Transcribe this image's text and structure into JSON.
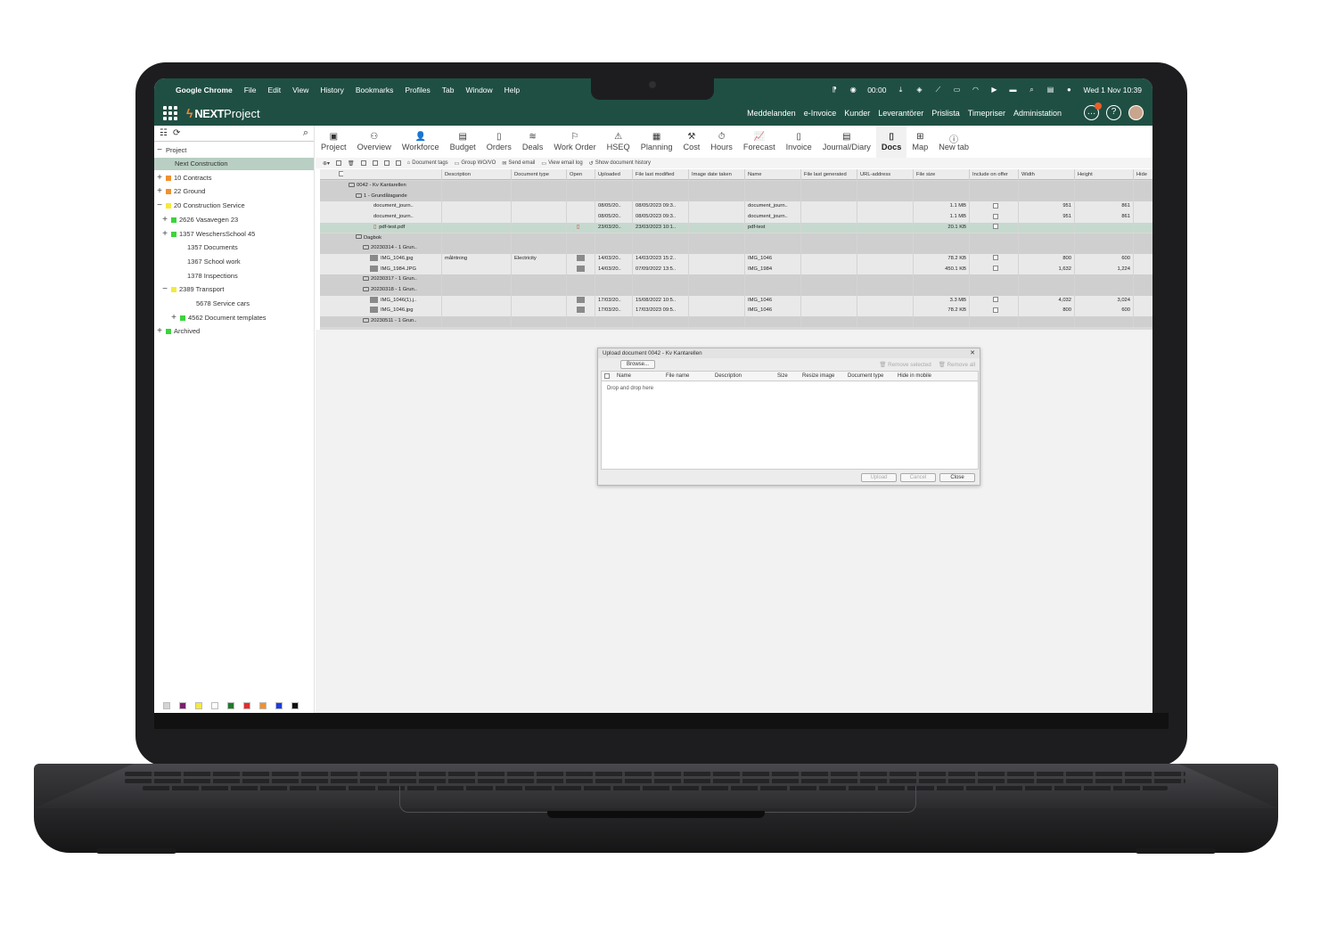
{
  "menubar": {
    "app": "Google Chrome",
    "items": [
      "File",
      "Edit",
      "View",
      "History",
      "Bookmarks",
      "Profiles",
      "Tab",
      "Window",
      "Help"
    ],
    "timer": "00:00",
    "datetime": "Wed 1 Nov 10:39"
  },
  "appbar": {
    "logo_mark": "NEXT",
    "logo_text": "Project",
    "nav": [
      "Meddelanden",
      "e-Invoice",
      "Kunder",
      "Leverantörer",
      "Prislista",
      "Timepriser",
      "Administation"
    ]
  },
  "sidebar": {
    "root": "Project",
    "items": [
      {
        "label": "Next Construction",
        "pm": "",
        "color": ""
      },
      {
        "label": "10 Contracts",
        "pm": "+",
        "color": "#f0902e"
      },
      {
        "label": "22 Ground",
        "pm": "+",
        "color": "#f0902e"
      },
      {
        "label": "20 Construction Service",
        "pm": "−",
        "color": "#f4ea3c"
      },
      {
        "label": "2626 Vasavegen 23",
        "pm": "+",
        "color": "#3cd43c"
      },
      {
        "label": "1357 WeschersSchool 45",
        "pm": "+",
        "color": "#3cd43c"
      },
      {
        "label": "1357 Documents",
        "pm": "",
        "color": ""
      },
      {
        "label": "1367 School work",
        "pm": "",
        "color": ""
      },
      {
        "label": "1378 Inspections",
        "pm": "",
        "color": ""
      },
      {
        "label": "2389 Transport",
        "pm": "−",
        "color": "#f4ea3c"
      },
      {
        "label": "5678 Service cars",
        "pm": "",
        "color": ""
      },
      {
        "label": "4562 Document templates",
        "pm": "+",
        "color": "#3cd43c"
      },
      {
        "label": "Archived",
        "pm": "+",
        "color": "#3cd43c"
      }
    ],
    "palette": [
      "#d4d4d4",
      "#7b1f6e",
      "#f4ea3c",
      "#ffffff",
      "#1f7a2c",
      "#e62b2b",
      "#f0902e",
      "#1c3de0",
      "#111111"
    ]
  },
  "modules": [
    {
      "label": "Project",
      "icon": "briefcase-icon",
      "glyph": "▣"
    },
    {
      "label": "Overview",
      "icon": "overview-icon",
      "glyph": "⚇"
    },
    {
      "label": "Workforce",
      "icon": "person-icon",
      "glyph": "👤"
    },
    {
      "label": "Budget",
      "icon": "budget-icon",
      "glyph": "▤"
    },
    {
      "label": "Orders",
      "icon": "orders-icon",
      "glyph": "▯"
    },
    {
      "label": "Deals",
      "icon": "deals-icon",
      "glyph": "≋"
    },
    {
      "label": "Work Order",
      "icon": "flag-icon",
      "glyph": "⚐"
    },
    {
      "label": "HSEQ",
      "icon": "warning-icon",
      "glyph": "⚠"
    },
    {
      "label": "Planning",
      "icon": "calendar-icon",
      "glyph": "▦"
    },
    {
      "label": "Cost",
      "icon": "cost-icon",
      "glyph": "⚒"
    },
    {
      "label": "Hours",
      "icon": "stopwatch-icon",
      "glyph": "⏱"
    },
    {
      "label": "Forecast",
      "icon": "chart-icon",
      "glyph": "📈"
    },
    {
      "label": "Invoice",
      "icon": "invoice-icon",
      "glyph": "▯"
    },
    {
      "label": "Journal/Diary",
      "icon": "journal-icon",
      "glyph": "▤"
    },
    {
      "label": "Docs",
      "icon": "document-icon",
      "glyph": "▯",
      "active": true
    },
    {
      "label": "Map",
      "icon": "map-icon",
      "glyph": "⊞"
    },
    {
      "label": "New tab",
      "icon": "info-icon",
      "glyph": "ⓘ"
    }
  ],
  "actions": [
    "Document tags",
    "Group WO/VO",
    "Send email",
    "View email log",
    "Show document history"
  ],
  "grid": {
    "headers": [
      "Description",
      "Document type",
      "Open",
      "Uploaded",
      "File last modified",
      "Image date taken",
      "Name",
      "File last generated",
      "URL-address",
      "File size",
      "Include on offer",
      "Width",
      "Height",
      "Hide"
    ],
    "rows": [
      {
        "tree": "0042 - Kv Kantarellen",
        "indent": 12,
        "kind": "folder",
        "style": "shade"
      },
      {
        "tree": "1 - Grundåtagande",
        "indent": 20,
        "kind": "folder",
        "style": "shade"
      },
      {
        "tree": "document_journ..",
        "indent": 40,
        "kind": "file",
        "style": "light",
        "uploaded": "08/05/20..",
        "modified": "08/05/2023 09:3..",
        "name": "document_journ..",
        "size": "1.1 MB",
        "w": "951",
        "h": "861"
      },
      {
        "tree": "document_journ..",
        "indent": 40,
        "kind": "file",
        "style": "light",
        "uploaded": "08/05/20..",
        "modified": "08/05/2023 09:3..",
        "name": "document_journ..",
        "size": "1.1 MB",
        "w": "951",
        "h": "861"
      },
      {
        "tree": "pdf-test.pdf",
        "indent": 40,
        "kind": "pdf",
        "style": "hl",
        "uploaded": "23/03/20..",
        "modified": "23/03/2023 10:1..",
        "name": "pdf-test",
        "size": "20.1 KB",
        "w": "",
        "h": ""
      },
      {
        "tree": "Dagbok",
        "indent": 20,
        "kind": "folder",
        "style": "shade"
      },
      {
        "tree": "20230314 - 1 Grun..",
        "indent": 28,
        "kind": "folder",
        "style": "shade"
      },
      {
        "tree": "IMG_1046.jpg",
        "indent": 36,
        "kind": "img",
        "style": "light",
        "desc": "målritning",
        "doctype": "Electricity",
        "uploaded": "14/03/20..",
        "modified": "14/03/2023 15:2..",
        "name": "IMG_1046",
        "size": "78.2 KB",
        "w": "800",
        "h": "600"
      },
      {
        "tree": "IMG_1984.JPG",
        "indent": 36,
        "kind": "img",
        "style": "light",
        "uploaded": "14/03/20..",
        "modified": "07/09/2022 13:5..",
        "name": "IMG_1984",
        "size": "450.1 KB",
        "w": "1,632",
        "h": "1,224"
      },
      {
        "tree": "20230317 - 1 Grun..",
        "indent": 28,
        "kind": "folder",
        "style": "shade"
      },
      {
        "tree": "20230318 - 1 Grun..",
        "indent": 28,
        "kind": "folder",
        "style": "shade"
      },
      {
        "tree": "IMG_1046(1).j..",
        "indent": 36,
        "kind": "img",
        "style": "light",
        "uploaded": "17/03/20..",
        "modified": "15/08/2022 10:5..",
        "name": "IMG_1046",
        "size": "3.3 MB",
        "w": "4,032",
        "h": "3,024"
      },
      {
        "tree": "IMG_1046.jpg",
        "indent": 36,
        "kind": "img",
        "style": "light",
        "uploaded": "17/03/20..",
        "modified": "17/03/2023 09:5..",
        "name": "IMG_1046",
        "size": "78.2 KB",
        "w": "800",
        "h": "600"
      },
      {
        "tree": "20230511 - 1 Grun..",
        "indent": 28,
        "kind": "folder",
        "style": "shade"
      }
    ]
  },
  "dialog": {
    "title": "Upload document 0042 - Kv Kantarellen",
    "browse": "Browse...",
    "remove_selected": "Remove selected",
    "remove_all": "Remove all",
    "columns": [
      "Name",
      "File name",
      "Description",
      "Size",
      "Resize image",
      "Document type",
      "Hide in mobile"
    ],
    "drop": "Drop and drop here",
    "upload": "Upload",
    "cancel": "Cancel",
    "close": "Close"
  }
}
